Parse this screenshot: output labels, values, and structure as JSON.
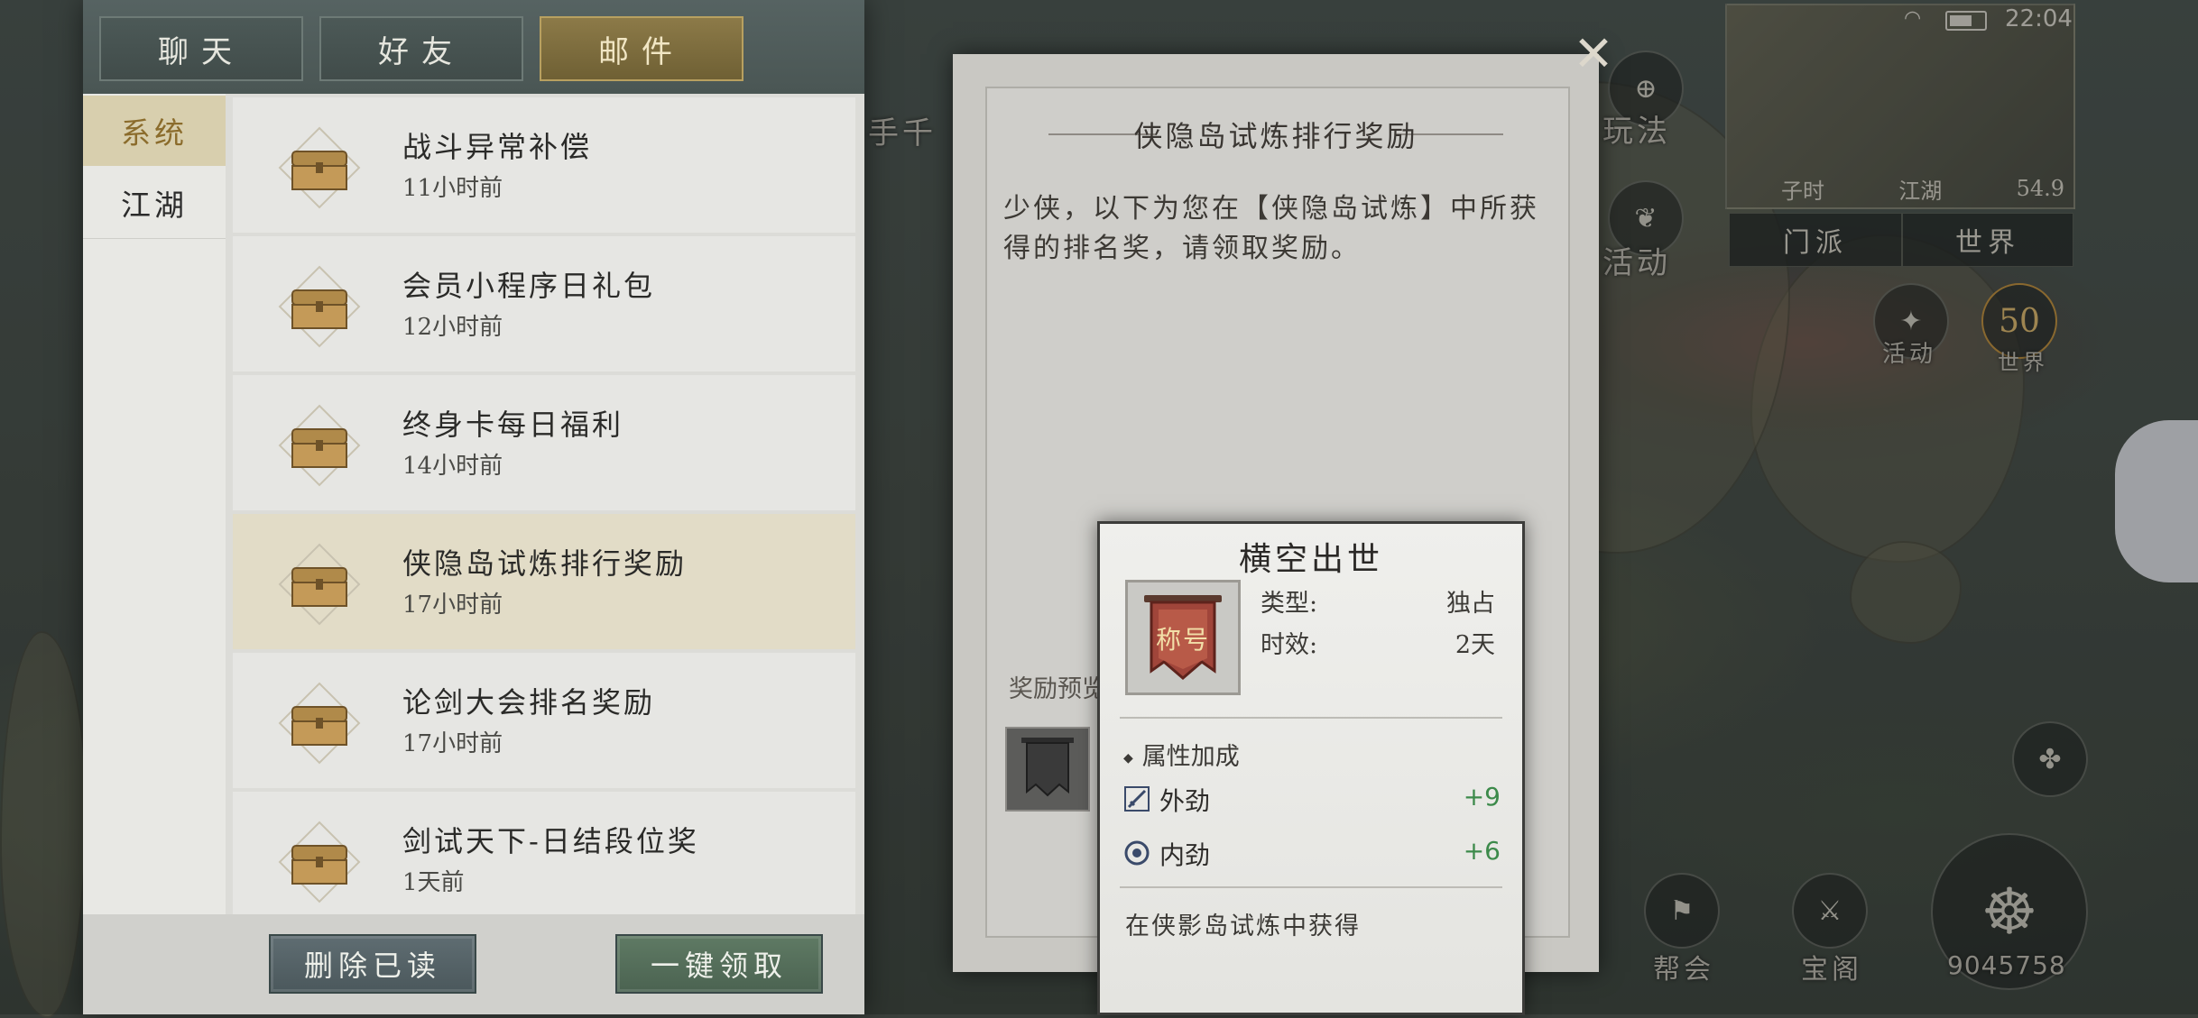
{
  "status": {
    "clock": "22:04"
  },
  "map": {
    "minimap": {
      "time_label": "子时",
      "region": "江湖",
      "value": "54.9"
    },
    "tabs": [
      "门派",
      "世界"
    ],
    "labels": {
      "play": "玩法",
      "activity": "活动",
      "event": "活动",
      "world_level": "50",
      "world_label": "世界",
      "guild": "帮会",
      "treasure": "宝阁",
      "power": "9045758",
      "npc_left": "手千"
    }
  },
  "top_tabs": [
    {
      "label": "聊天",
      "active": false
    },
    {
      "label": "好友",
      "active": false
    },
    {
      "label": "邮件",
      "active": true
    }
  ],
  "categories": [
    {
      "label": "系统",
      "active": true
    },
    {
      "label": "江湖",
      "active": false
    }
  ],
  "mails": [
    {
      "title": "战斗异常补偿",
      "time": "11小时前",
      "selected": false
    },
    {
      "title": "会员小程序日礼包",
      "time": "12小时前",
      "selected": false
    },
    {
      "title": "终身卡每日福利",
      "time": "14小时前",
      "selected": false
    },
    {
      "title": "侠隐岛试炼排行奖励",
      "time": "17小时前",
      "selected": true
    },
    {
      "title": "论剑大会排名奖励",
      "time": "17小时前",
      "selected": false
    },
    {
      "title": "剑试天下-日结段位奖",
      "time": "1天前",
      "selected": false
    }
  ],
  "buttons": {
    "delete_read": "删除已读",
    "claim_all": "一键领取"
  },
  "detail": {
    "title": "侠隐岛试炼排行奖励",
    "body": "少侠，以下为您在【侠隐岛试炼】中所获得的排名奖，请领取奖励。",
    "preview_label": "奖励预览"
  },
  "tooltip": {
    "title": "横空出世",
    "icon_text": "称号",
    "type_label": "类型:",
    "type_value": "独占",
    "duration_label": "时效:",
    "duration_value": "2天",
    "attr_header": "属性加成",
    "attrs": [
      {
        "label": "外劲",
        "value": "+9",
        "icon": "sword-icon"
      },
      {
        "label": "内劲",
        "value": "+6",
        "icon": "swirl-icon"
      }
    ],
    "source": "在侠影岛试炼中获得"
  },
  "colors": {
    "accent_gold": "#b8a060",
    "positive": "#3c8a4a",
    "banner_red": "#a0453a"
  }
}
